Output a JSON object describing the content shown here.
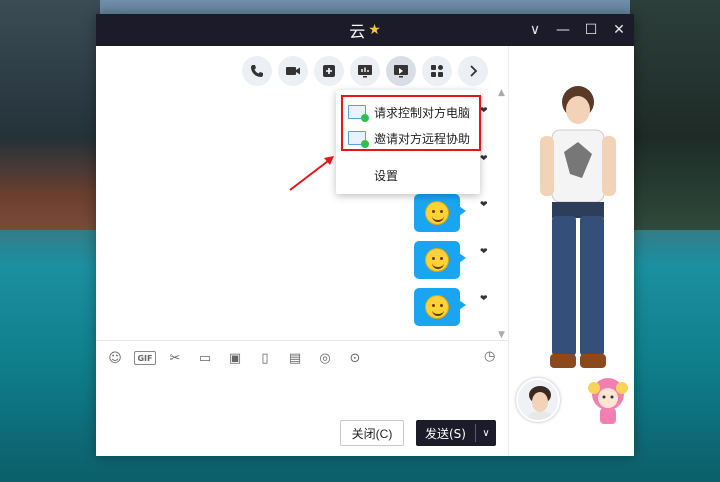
{
  "window": {
    "title": "云",
    "controls": {
      "dropdown": "∨",
      "minimize": "—",
      "maximize": "☐",
      "close": "✕"
    }
  },
  "toolbar": {
    "buttons": [
      "phone-icon",
      "video-icon",
      "add-icon",
      "screen-share-icon",
      "remote-desktop-icon",
      "apps-icon",
      "more-chevron-icon"
    ]
  },
  "dropdown_menu": {
    "items": [
      {
        "label": "请求控制对方电脑",
        "icon": "remote-control-icon"
      },
      {
        "label": "邀请对方远程协助",
        "icon": "remote-assist-icon"
      },
      {
        "label": "设置"
      }
    ]
  },
  "messages": [
    {
      "type": "emoji",
      "icon": "smile-emoji"
    },
    {
      "type": "emoji",
      "icon": "smile-emoji"
    },
    {
      "type": "emoji",
      "icon": "smile-emoji"
    },
    {
      "type": "emoji",
      "icon": "smile-emoji"
    }
  ],
  "input_tools": {
    "items": [
      "emoji-icon",
      "gif-icon",
      "scissors-icon",
      "folder-icon",
      "image-icon",
      "shake-icon",
      "red-packet-icon",
      "music-icon",
      "more-icon"
    ],
    "gif_label": "GIF",
    "history_icon": "clock-icon"
  },
  "buttons": {
    "close_label": "关闭(C)",
    "send_label": "发送(S)",
    "send_dropdown": "∨"
  },
  "colors": {
    "titlebar": "#1b1b2a",
    "bubble": "#1aa5f2",
    "highlight": "#e8141a",
    "send": "#1b1b2a"
  }
}
